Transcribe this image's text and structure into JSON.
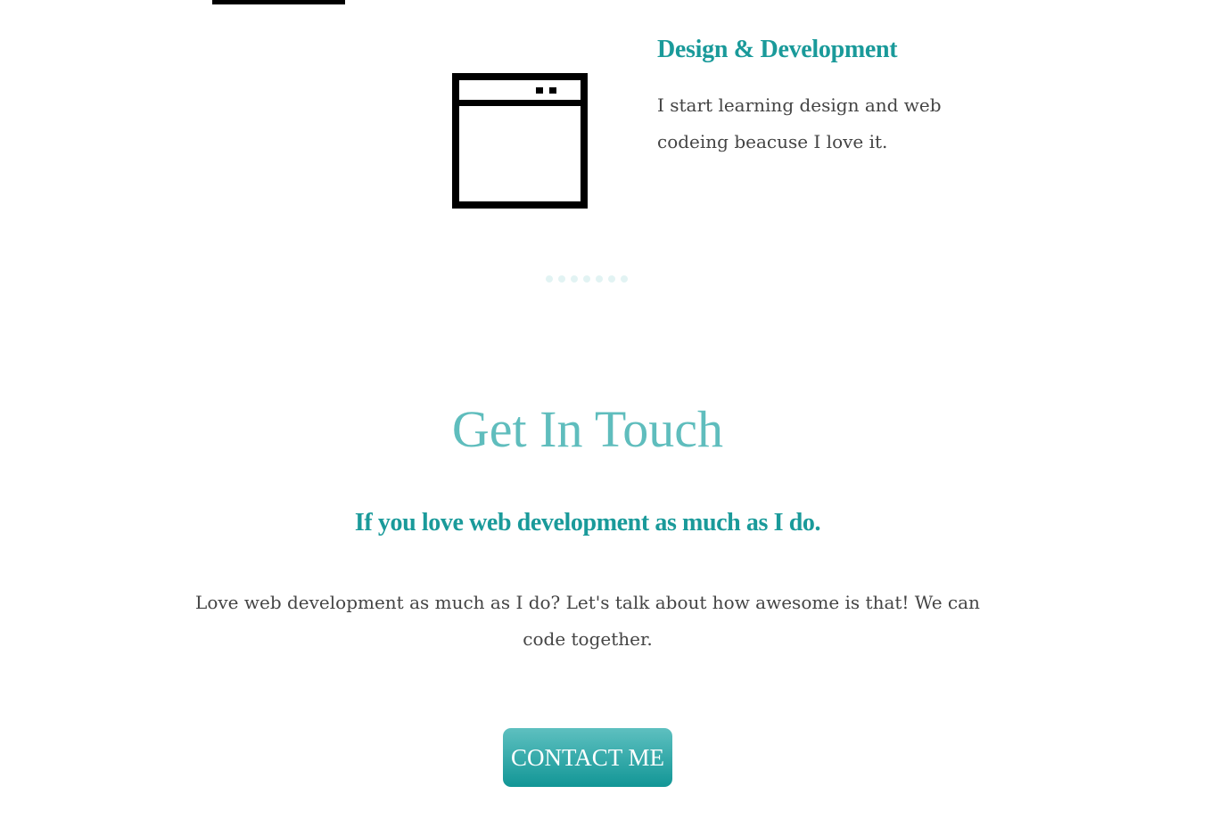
{
  "service": {
    "icon": "browser-window-icon",
    "title": "Design & Development",
    "description": "I start learning design and web codeing beacuse I love it."
  },
  "carousel": {
    "dot_count": 7
  },
  "contact": {
    "heading": "Get In Touch",
    "subheading": "If you love web development as much as I do.",
    "text": "Love web development as much as I do? Let's talk about how awesome is that! We can code together.",
    "button_label": "CONTACT ME"
  },
  "colors": {
    "accent": "#1a9a9a",
    "heading": "#5fbdbd",
    "dot": "#e2f3f3",
    "button_top": "#5ec0c0",
    "button_bottom": "#129696"
  }
}
